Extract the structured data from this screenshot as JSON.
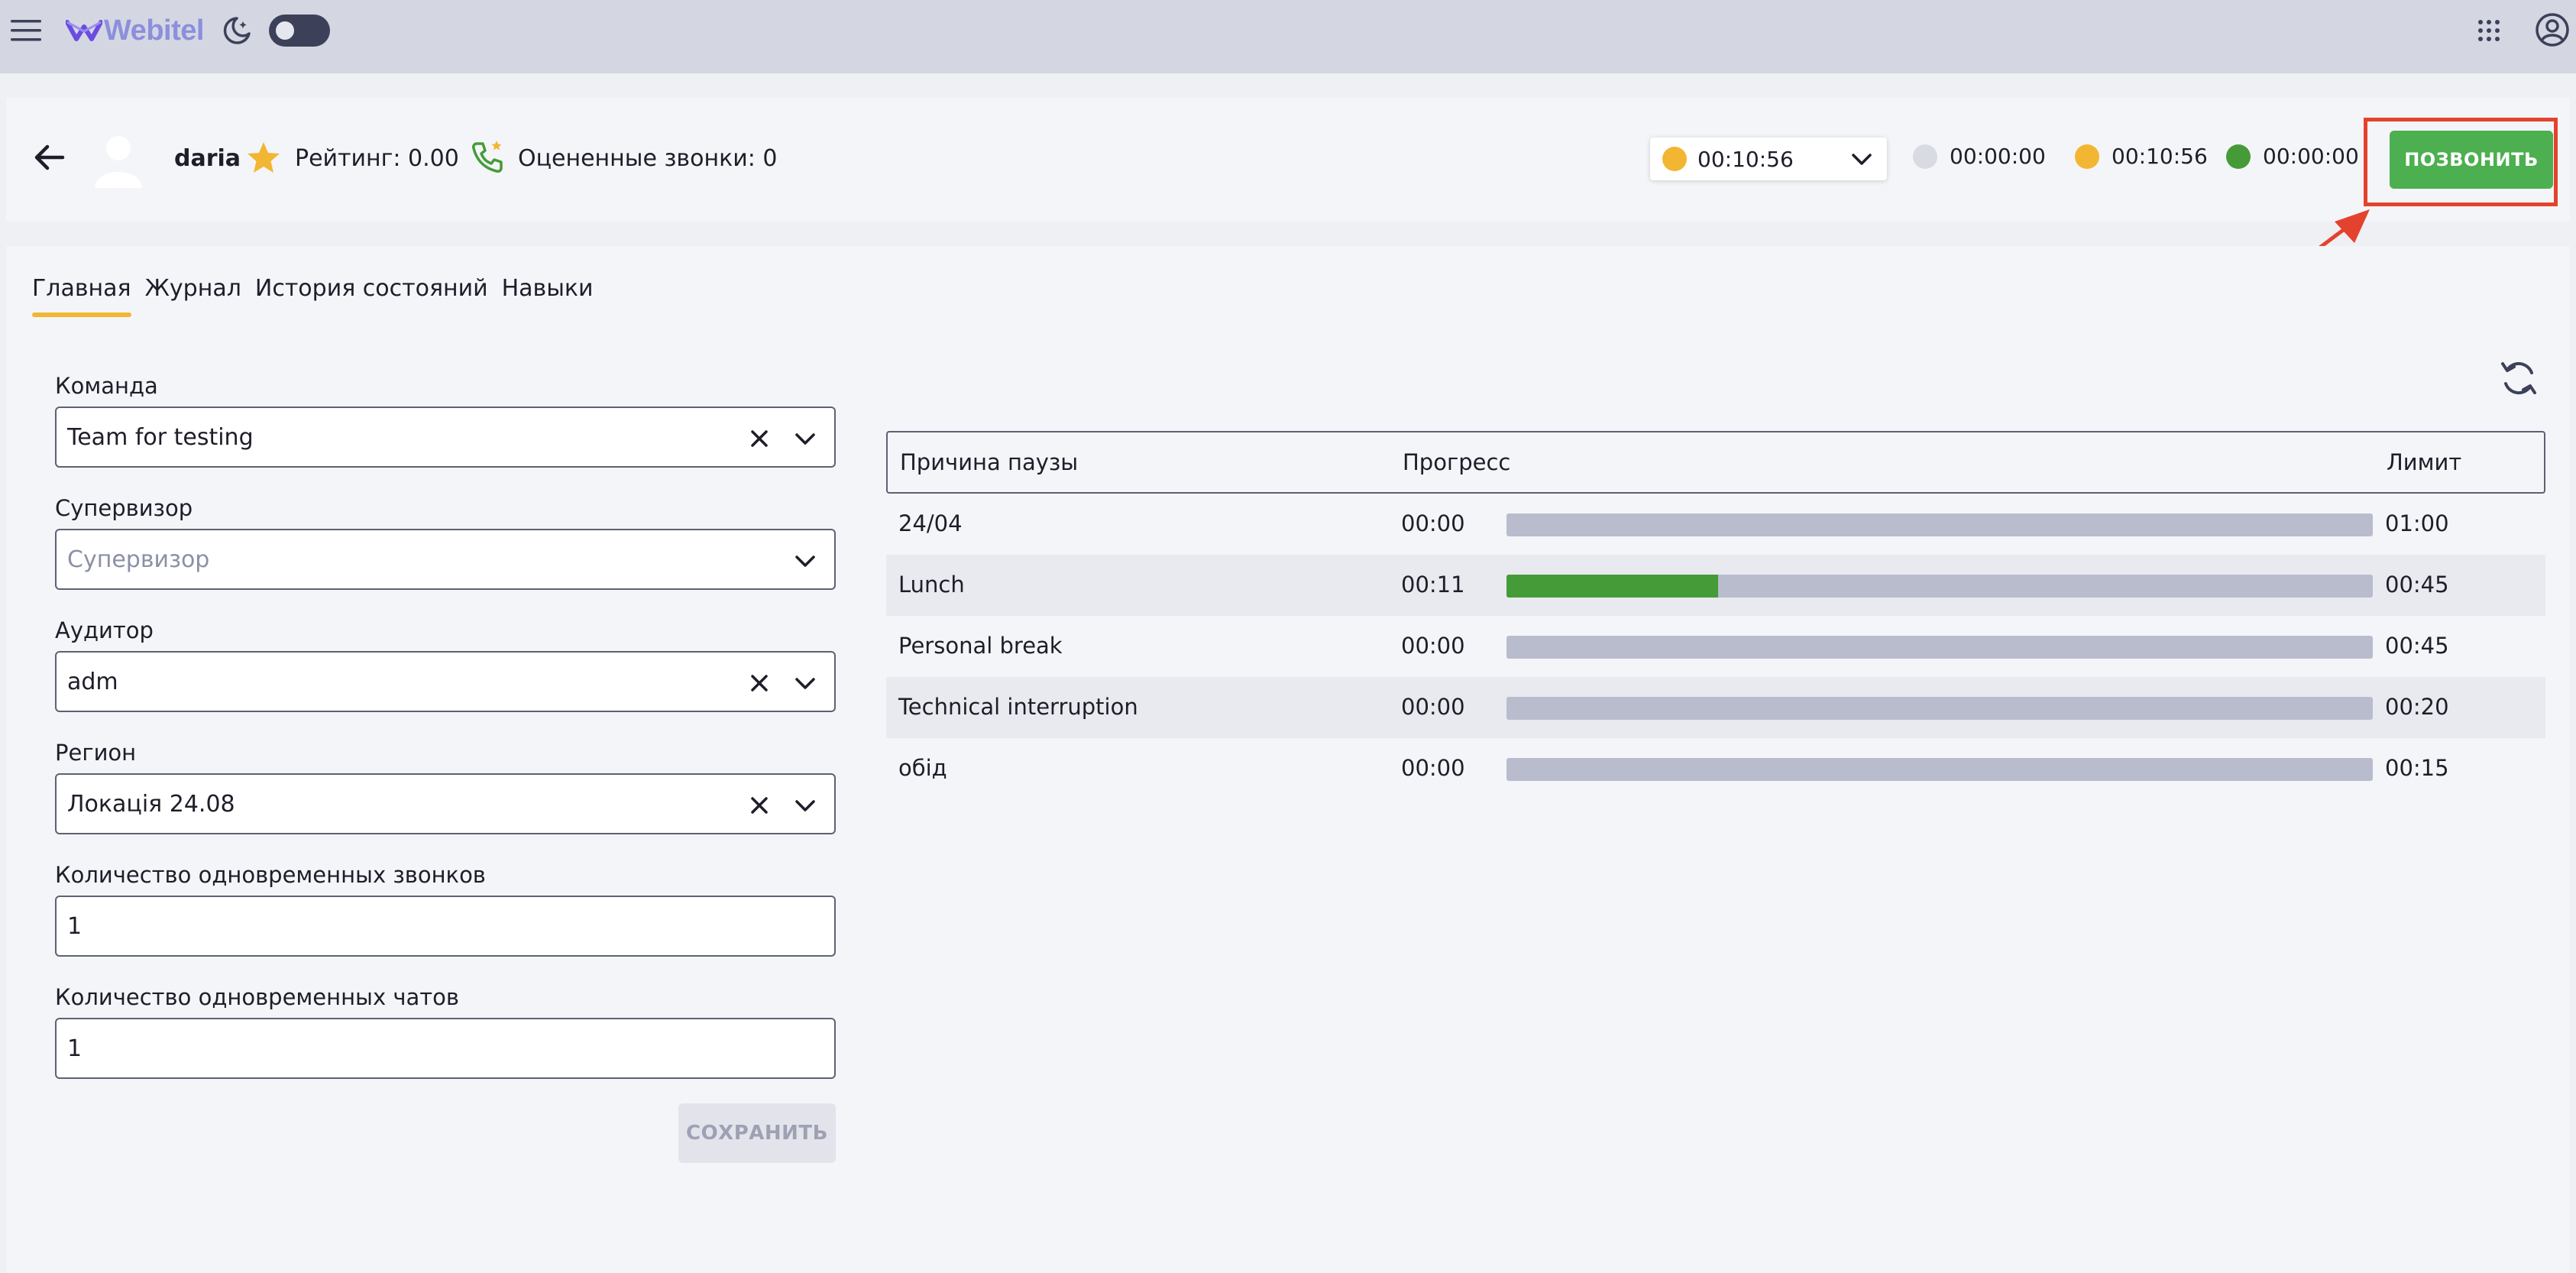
{
  "app": {
    "logo_text": "Webitel"
  },
  "agent": {
    "name": "daria",
    "rating": "Рейтинг: 0.00",
    "rated_calls": "Оцененные звонки: 0"
  },
  "status": {
    "selected_value": "00:10:56",
    "selected_color": "#f2b632",
    "timers": [
      {
        "value": "00:00:00",
        "color": "#d9dbe3"
      },
      {
        "value": "00:10:56",
        "color": "#f2b632"
      },
      {
        "value": "00:00:00",
        "color": "#459b38"
      }
    ]
  },
  "call_button": {
    "label": "ПОЗВОНИТЬ",
    "color": "#4caf50"
  },
  "annotation": {
    "color": "#e3432e"
  },
  "tabs": [
    {
      "label": "Главная",
      "active": true
    },
    {
      "label": "Журнал",
      "active": false
    },
    {
      "label": "История состояний",
      "active": false
    },
    {
      "label": "Навыки",
      "active": false
    }
  ],
  "form": {
    "team": {
      "label": "Команда",
      "value": "Team for testing"
    },
    "supervisor": {
      "label": "Супервизор",
      "placeholder": "Супервизор"
    },
    "auditor": {
      "label": "Аудитор",
      "value": "adm"
    },
    "region": {
      "label": "Регион",
      "value": "Локація 24.08"
    },
    "concurrent_calls": {
      "label": "Количество одновременных звонков",
      "value": "1"
    },
    "concurrent_chats": {
      "label": "Количество одновременных чатов",
      "value": "1"
    },
    "save_label": "СОХРАНИТЬ"
  },
  "pause_table": {
    "headers": {
      "reason": "Причина паузы",
      "progress": "Прогресс",
      "limit": "Лимит"
    },
    "rows": [
      {
        "reason": "24/04",
        "used": "00:00",
        "limit": "01:00",
        "progress": 0
      },
      {
        "reason": "Lunch",
        "used": "00:11",
        "limit": "00:45",
        "progress": 0.244
      },
      {
        "reason": "Personal break",
        "used": "00:00",
        "limit": "00:45",
        "progress": 0
      },
      {
        "reason": "Technical interruption",
        "used": "00:00",
        "limit": "00:20",
        "progress": 0
      },
      {
        "reason": "обід",
        "used": "00:00",
        "limit": "00:15",
        "progress": 0
      }
    ]
  }
}
